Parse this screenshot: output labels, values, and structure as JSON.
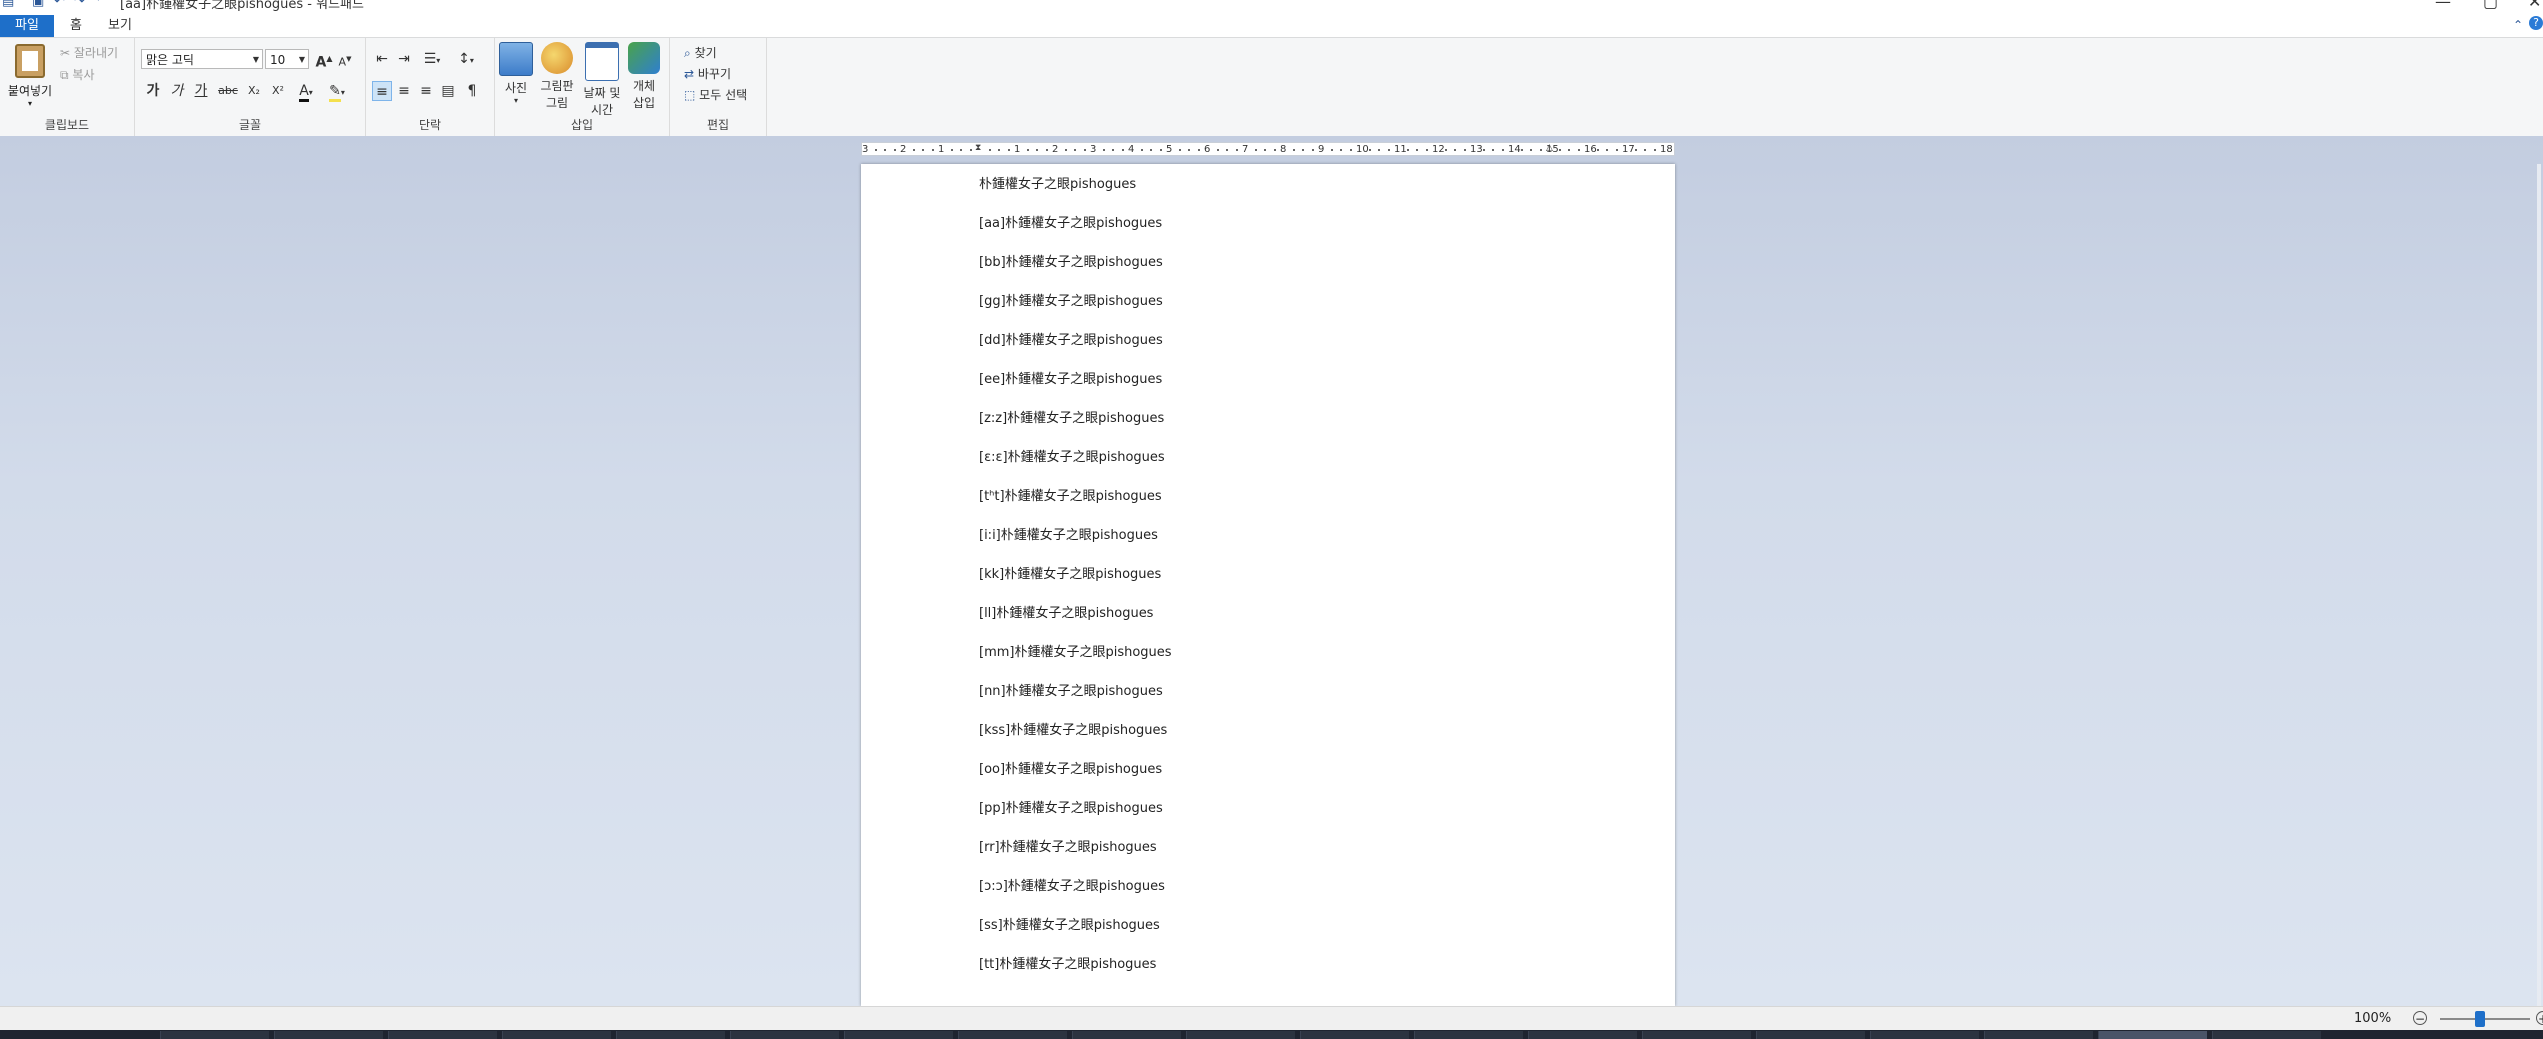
{
  "titlebar": {
    "title": "[aa]朴鍾權女子之眼pishogues - 워드패드",
    "quick_access": [
      "save-icon",
      "undo-icon",
      "redo-icon",
      "customize-icon"
    ],
    "controls": {
      "minimize": "—",
      "maximize": "▢",
      "close": "✕"
    }
  },
  "tabs": [
    {
      "label": "파일"
    },
    {
      "label": "홈"
    },
    {
      "label": "보기"
    }
  ],
  "ribbon": {
    "clipboard": {
      "paste": "붙여넣기",
      "cut": "잘라내기",
      "copy": "복사",
      "label": "클립보드"
    },
    "font": {
      "family": "맑은 고딕",
      "size": "10",
      "grow": "A",
      "shrink": "A",
      "bold": "가",
      "italic": "가",
      "underline": "가",
      "strike": "abc",
      "subscript": "X₂",
      "superscript": "X²",
      "color": "A",
      "highlight": "✎",
      "label": "글꼴"
    },
    "paragraph": {
      "label": "단락"
    },
    "insert": {
      "picture": "사진",
      "paint_line1": "그림판",
      "paint_line2": "그림",
      "datetime_line1": "날짜 및",
      "datetime_line2": "시간",
      "object_line1": "개체",
      "object_line2": "삽입",
      "label": "삽입"
    },
    "edit": {
      "find": "찾기",
      "replace": "바꾸기",
      "select_all": "모두 선택",
      "label": "편집"
    }
  },
  "ruler": {
    "numbers": [
      "3",
      "2",
      "1",
      "1",
      "2",
      "3",
      "4",
      "5",
      "6",
      "7",
      "8",
      "9",
      "10",
      "11",
      "12",
      "13",
      "14",
      "15",
      "16",
      "17",
      "18"
    ]
  },
  "document": {
    "lines": [
      "朴鍾權女子之眼pishogues",
      "[aa]朴鍾權女子之眼pishogues",
      "[bb]朴鍾權女子之眼pishogues",
      "[gg]朴鍾權女子之眼pishogues",
      "[dd]朴鍾權女子之眼pishogues",
      "[ee]朴鍾權女子之眼pishogues",
      "[z:z]朴鍾權女子之眼pishogues",
      "[ɛ:ɛ]朴鍾權女子之眼pishogues",
      "[tʰt]朴鍾權女子之眼pishogues",
      "[i:i]朴鍾權女子之眼pishogues",
      "[kk]朴鍾權女子之眼pishogues",
      "[ll]朴鍾權女子之眼pishogues",
      "[mm]朴鍾權女子之眼pishogues",
      "[nn]朴鍾權女子之眼pishogues",
      "[kss]朴鍾權女子之眼pishogues",
      "[oo]朴鍾權女子之眼pishogues",
      "[pp]朴鍾權女子之眼pishogues",
      "[rr]朴鍾權女子之眼pishogues",
      "[ɔ:ɔ]朴鍾權女子之眼pishogues",
      "[ss]朴鍾權女子之眼pishogues",
      "[tt]朴鍾權女子之眼pishogues"
    ]
  },
  "statusbar": {
    "zoom_label": "100%",
    "zoom_level": 1.0,
    "zoom_minus": "−",
    "zoom_plus": "+"
  },
  "colors": {
    "accent": "#1e6fc9",
    "workspace": "#d2dbea",
    "ribbon_bg": "#f5f6f7"
  }
}
